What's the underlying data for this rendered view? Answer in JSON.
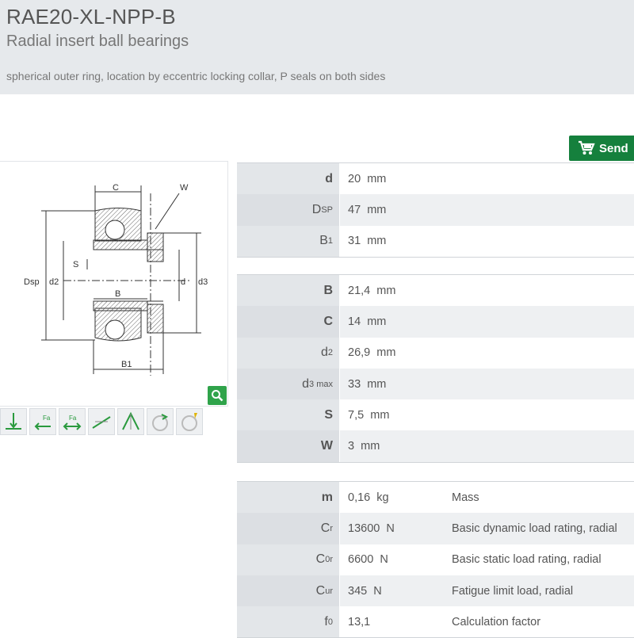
{
  "header": {
    "title": "RAE20-XL-NPP-B",
    "subtitle": "Radial insert ball bearings",
    "description": "spherical outer ring, location by eccentric locking collar, P seals on both sides"
  },
  "send_button": {
    "label": "Send",
    "icon": "cart-icon"
  },
  "drawing": {
    "labels": {
      "C": "C",
      "W": "W",
      "S": "S",
      "B": "B",
      "B1": "B1",
      "Dsp": "Dsp",
      "d2": "d2",
      "d": "d",
      "d3": "d3"
    }
  },
  "load_icons": [
    "radial-load-icon",
    "axial-load-left-icon",
    "axial-load-both-icon",
    "tilting-icon",
    "angle-icon",
    "rotation-icon",
    "speed-icon"
  ],
  "table1": [
    {
      "sym": "d",
      "sub": "",
      "value": "20",
      "unit": "mm"
    },
    {
      "sym": "D",
      "sub": "SP",
      "value": "47",
      "unit": "mm"
    },
    {
      "sym": "B",
      "sub": "1",
      "value": "31",
      "unit": "mm"
    }
  ],
  "table2": [
    {
      "sym": "B",
      "sub": "",
      "value": "21,4",
      "unit": "mm"
    },
    {
      "sym": "C",
      "sub": "",
      "value": "14",
      "unit": "mm"
    },
    {
      "sym": "d",
      "sub": "2",
      "value": "26,9",
      "unit": "mm"
    },
    {
      "sym": "d",
      "sub": "3 max",
      "value": "33",
      "unit": "mm"
    },
    {
      "sym": "S",
      "sub": "",
      "value": "7,5",
      "unit": "mm"
    },
    {
      "sym": "W",
      "sub": "",
      "value": "3",
      "unit": "mm"
    }
  ],
  "table3": [
    {
      "sym": "m",
      "sub": "",
      "value": "0,16",
      "unit": "kg",
      "desc": "Mass"
    },
    {
      "sym": "C",
      "sub": "r",
      "value": "13600",
      "unit": "N",
      "desc": "Basic dynamic load rating, radial"
    },
    {
      "sym": "C",
      "sub": "0r",
      "value": "6600",
      "unit": "N",
      "desc": "Basic static load rating, radial"
    },
    {
      "sym": "C",
      "sub": "ur",
      "value": "345",
      "unit": "N",
      "desc": "Fatigue limit load, radial"
    },
    {
      "sym": "f",
      "sub": "0",
      "value": "13,1",
      "unit": "",
      "desc": "Calculation factor"
    }
  ]
}
